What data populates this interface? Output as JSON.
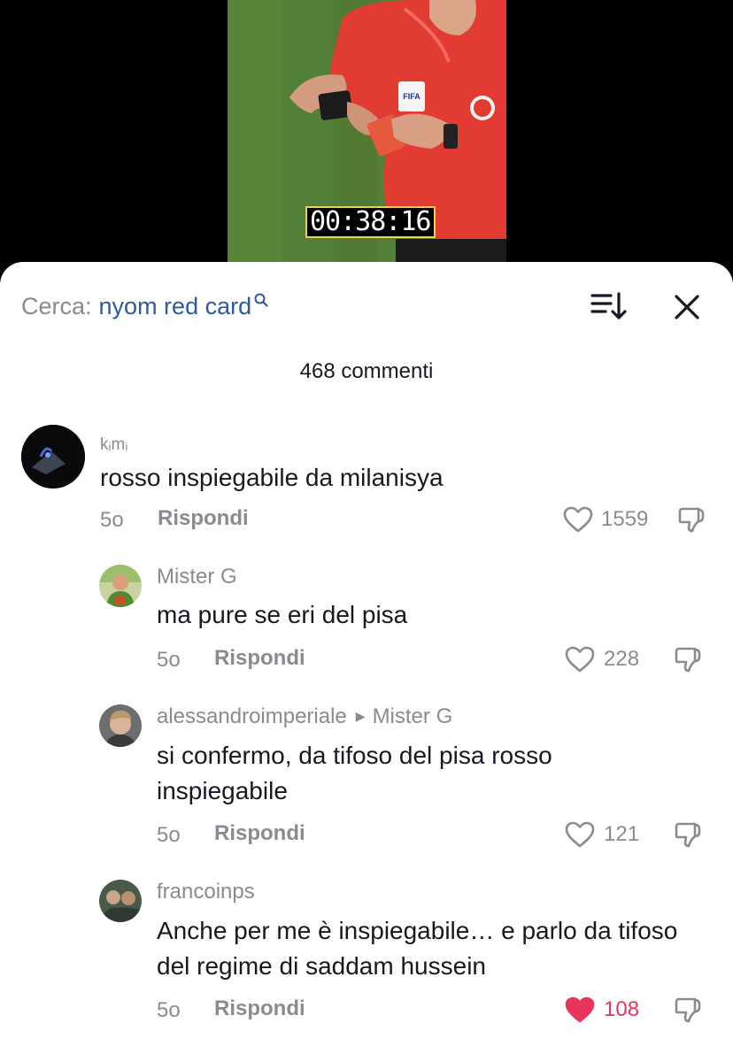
{
  "video": {
    "timestamp": "00:38:16",
    "badge_text": "FIFA"
  },
  "header": {
    "search_prefix": "Cerca:",
    "search_term": "nyom red card",
    "icons": {
      "search": "search-icon",
      "sort": "sort-icon",
      "close": "close-icon"
    }
  },
  "comments_count": "468 commenti",
  "comments": [
    {
      "username": "kᵢmᵢ",
      "text": "rosso inspiegabile da milanisya",
      "age": "5o",
      "reply_label": "Rispondi",
      "likes": "1559",
      "liked": false
    },
    {
      "username": "Mister G",
      "text": "ma pure se eri del pisa",
      "age": "5o",
      "reply_label": "Rispondi",
      "likes": "228",
      "liked": false
    },
    {
      "username": "alessandroimperiale",
      "reply_to": "Mister G",
      "text": "si confermo, da tifoso del pisa rosso inspiegabile",
      "age": "5o",
      "reply_label": "Rispondi",
      "likes": "121",
      "liked": false
    },
    {
      "username": "francoinps",
      "text": "Anche per me è inspiegabile… e parlo da tifoso del regime di saddam hussein",
      "age": "5o",
      "reply_label": "Rispondi",
      "likes": "108",
      "liked": true
    }
  ],
  "colors": {
    "liked_heart": "#e8345b",
    "search_term": "#2c5aa0",
    "muted_text": "#8a8b91"
  }
}
